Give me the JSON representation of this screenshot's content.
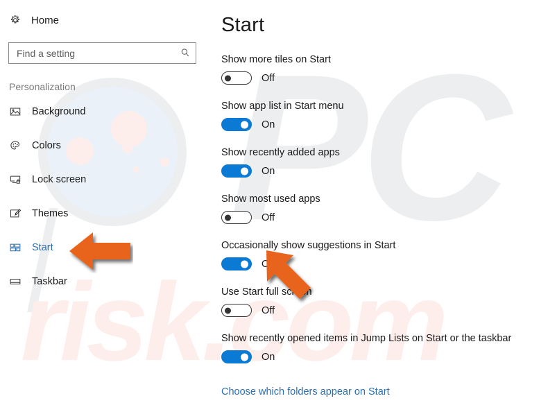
{
  "sidebar": {
    "home": {
      "label": "Home",
      "icon": "gear-icon"
    },
    "search": {
      "value": "",
      "placeholder": "Find a setting",
      "icon": "search-icon"
    },
    "section_title": "Personalization",
    "items": [
      {
        "label": "Background",
        "icon": "image-icon",
        "selected": false
      },
      {
        "label": "Colors",
        "icon": "palette-icon",
        "selected": false
      },
      {
        "label": "Lock screen",
        "icon": "lock-screen-icon",
        "selected": false
      },
      {
        "label": "Themes",
        "icon": "brush-icon",
        "selected": false
      },
      {
        "label": "Start",
        "icon": "start-tiles-icon",
        "selected": true
      },
      {
        "label": "Taskbar",
        "icon": "taskbar-icon",
        "selected": false
      }
    ]
  },
  "main": {
    "title": "Start",
    "settings": [
      {
        "label": "Show more tiles on Start",
        "state": "Off",
        "on": false
      },
      {
        "label": "Show app list in Start menu",
        "state": "On",
        "on": true
      },
      {
        "label": "Show recently added apps",
        "state": "On",
        "on": true
      },
      {
        "label": "Show most used apps",
        "state": "Off",
        "on": false
      },
      {
        "label": "Occasionally show suggestions in Start",
        "state": "On",
        "on": true
      },
      {
        "label": "Use Start full screen",
        "state": "Off",
        "on": false
      },
      {
        "label": "Show recently opened items in Jump Lists on Start or the taskbar",
        "state": "On",
        "on": true
      }
    ],
    "link": "Choose which folders appear on Start"
  },
  "annotations": {
    "arrow_color": "#e8641c",
    "arrows": [
      {
        "name": "arrow-pointing-start-nav",
        "direction": "left"
      },
      {
        "name": "arrow-pointing-suggestions-toggle",
        "direction": "up-left"
      }
    ]
  },
  "watermark": {
    "top_text": "PC",
    "bottom_text": "risk.com",
    "color": "#eceef0",
    "accent": "#fdeeeb"
  },
  "colors": {
    "accent_blue": "#0b7ad4",
    "link_blue": "#2a6fb5",
    "text": "#1a1a1a",
    "muted": "#7b7b7b"
  }
}
